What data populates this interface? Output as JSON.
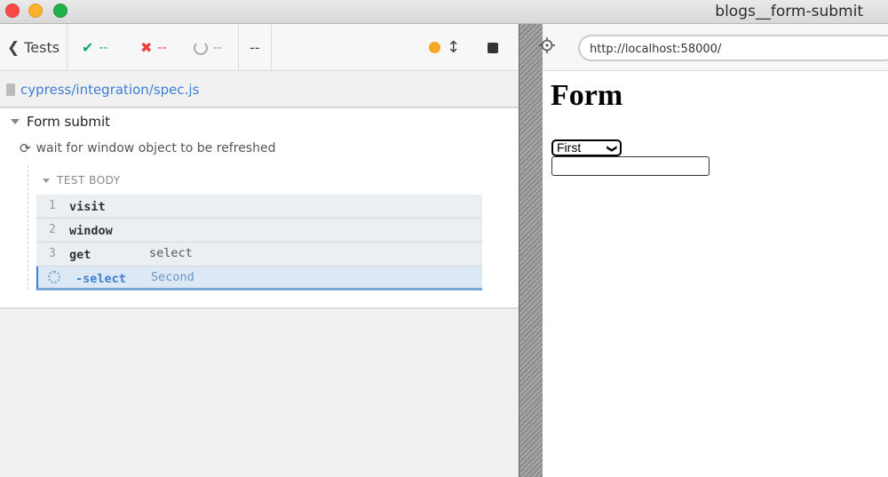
{
  "window": {
    "title": "blogs__form-submit"
  },
  "toolbar": {
    "tests_label": "Tests",
    "passed_count": "--",
    "failed_count": "--",
    "pending_count": "--",
    "duration": "--"
  },
  "spec": {
    "path": "cypress/integration/spec.js"
  },
  "suite": {
    "title": "Form submit"
  },
  "test": {
    "title": "wait for window object to be refreshed",
    "body_label": "TEST BODY",
    "commands": [
      {
        "num": "1",
        "name": "visit",
        "message": ""
      },
      {
        "num": "2",
        "name": "window",
        "message": ""
      },
      {
        "num": "3",
        "name": "get",
        "message": "select"
      },
      {
        "num": "",
        "name": "-select",
        "message": "Second"
      }
    ]
  },
  "browser": {
    "url": "http://localhost:58000/"
  },
  "app": {
    "heading": "Form",
    "select_value": "First"
  },
  "colors": {
    "passed": "#1ea670",
    "failed": "#e94141",
    "accent": "#3b7fd6",
    "running": "#f5a623"
  }
}
